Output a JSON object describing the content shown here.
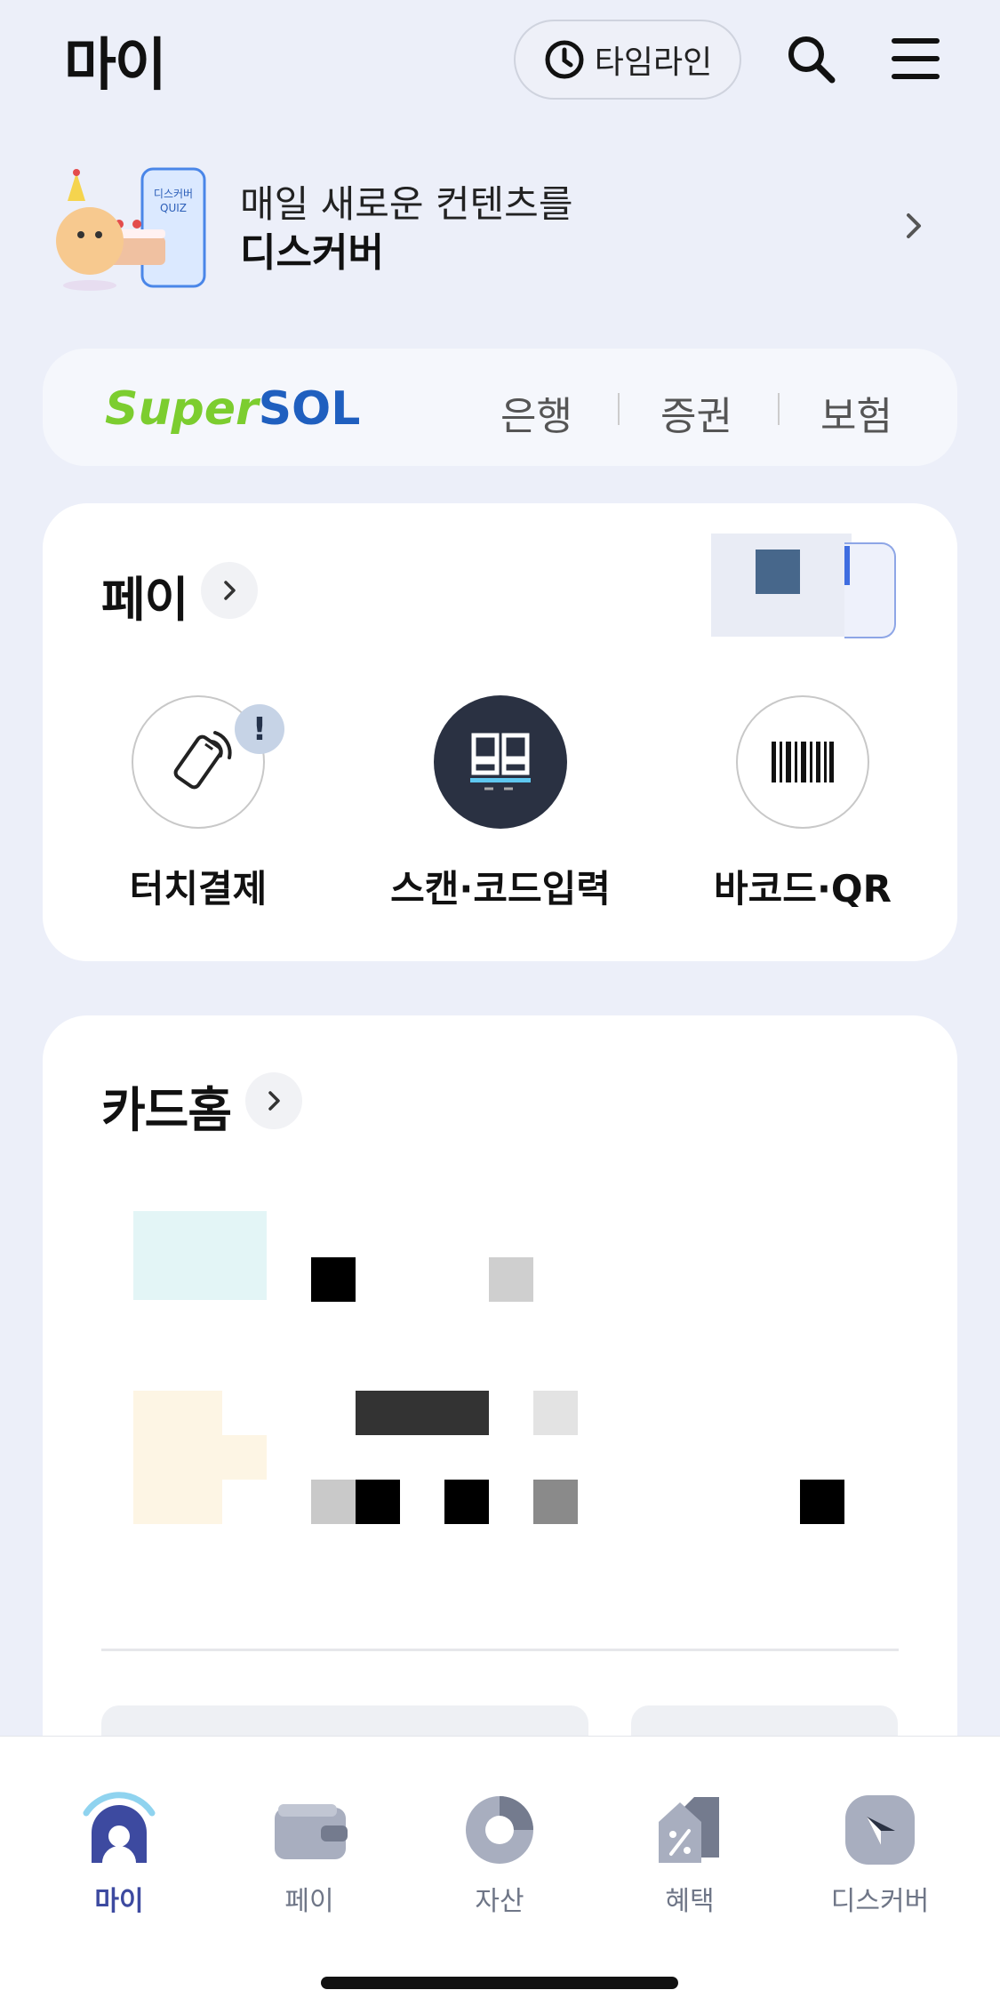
{
  "header": {
    "title": "마이",
    "timeline_label": "타임라인"
  },
  "discover_banner": {
    "line1": "매일 새로운 컨텐츠를",
    "line2": "디스커버",
    "phone_text": "디스커버",
    "phone_subtext": "QUIZ"
  },
  "supersol": {
    "logo_super": "Super",
    "logo_sol": "SOL",
    "links": [
      "은행",
      "증권",
      "보험"
    ]
  },
  "pay_card": {
    "title": "페이",
    "actions": [
      {
        "label": "터치결제",
        "icon": "nfc-phone-icon",
        "badge": "!"
      },
      {
        "label": "스캔·코드입력",
        "icon": "qr-scan-icon"
      },
      {
        "label": "바코드·QR",
        "icon": "barcode-icon"
      }
    ]
  },
  "card_home": {
    "title": "카드홈"
  },
  "bottom_nav": {
    "items": [
      {
        "label": "마이",
        "icon": "my-icon",
        "active": true
      },
      {
        "label": "페이",
        "icon": "wallet-icon",
        "active": false
      },
      {
        "label": "자산",
        "icon": "asset-pie-icon",
        "active": false
      },
      {
        "label": "혜택",
        "icon": "benefit-tag-icon",
        "active": false
      },
      {
        "label": "디스커버",
        "icon": "compass-icon",
        "active": false
      }
    ]
  },
  "colors": {
    "background": "#eceff9",
    "accent": "#3d4aa0",
    "pay_dark": "#2a3142",
    "supersol_green": "#7ccd2f",
    "supersol_blue": "#1f5fbf"
  }
}
